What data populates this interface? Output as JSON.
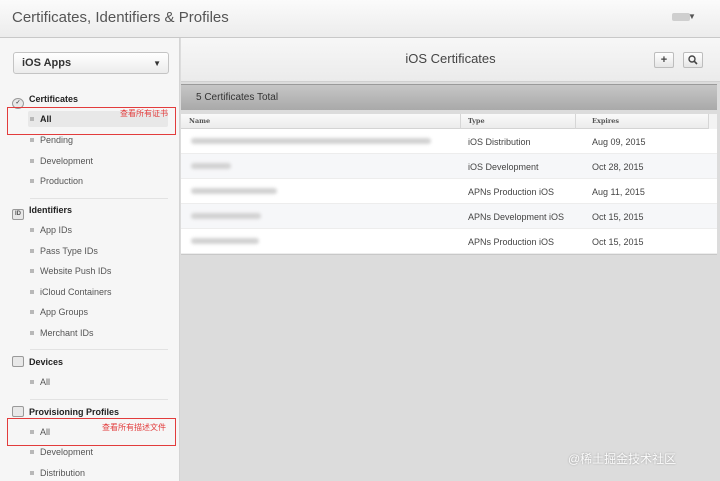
{
  "header": {
    "title": "Certificates, Identifiers & Profiles"
  },
  "sidebar": {
    "platform": "iOS Apps",
    "certificates": {
      "title": "Certificates",
      "items": [
        "All",
        "Pending",
        "Development",
        "Production"
      ]
    },
    "identifiers": {
      "title": "Identifiers",
      "items": [
        "App IDs",
        "Pass Type IDs",
        "Website Push IDs",
        "iCloud Containers",
        "App Groups",
        "Merchant IDs"
      ]
    },
    "devices": {
      "title": "Devices",
      "items": [
        "All"
      ]
    },
    "profiles": {
      "title": "Provisioning Profiles",
      "items": [
        "All",
        "Development",
        "Distribution"
      ]
    }
  },
  "annotations": {
    "certs_note": "查看所有证书",
    "profiles_note": "查看所有描述文件"
  },
  "main": {
    "title": "iOS Certificates",
    "total": "5 Certificates Total",
    "add_label": "+",
    "columns": [
      "Name",
      "Type",
      "Expires"
    ],
    "rows": [
      {
        "type": "iOS Distribution",
        "expires": "Aug 09, 2015"
      },
      {
        "type": "iOS Development",
        "expires": "Oct 28, 2015"
      },
      {
        "type": "APNs Production iOS",
        "expires": "Aug 11, 2015"
      },
      {
        "type": "APNs Development iOS",
        "expires": "Oct 15, 2015"
      },
      {
        "type": "APNs Production iOS",
        "expires": "Oct 15, 2015"
      }
    ]
  },
  "watermark": "@稀土掘金技术社区",
  "icons": {
    "certificates": "certificate-icon",
    "identifiers": "id-icon",
    "devices": "device-icon",
    "profiles": "profile-icon",
    "search": "search-icon",
    "add": "plus-icon"
  },
  "colors": {
    "annotation": "#e23c3c"
  }
}
